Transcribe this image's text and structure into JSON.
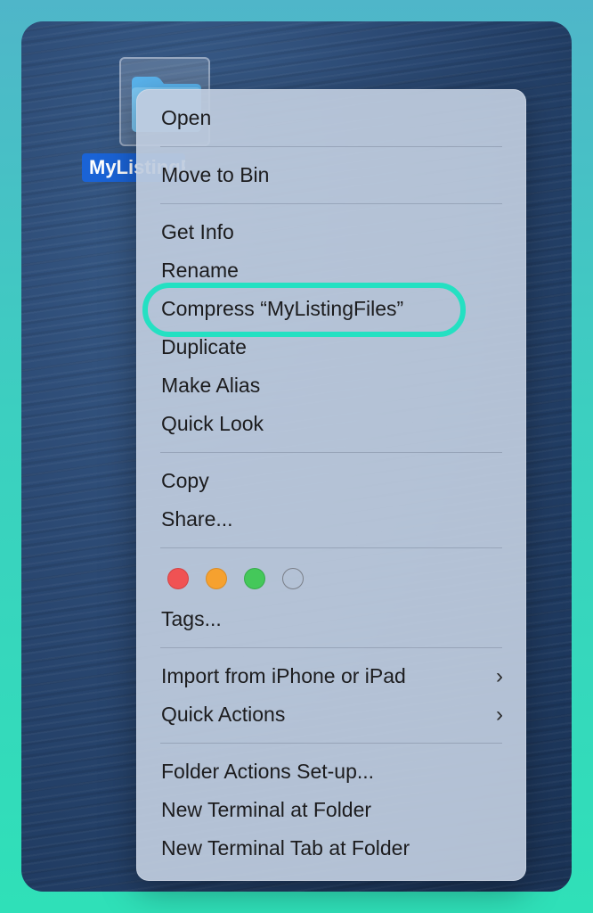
{
  "desktop": {
    "folder": {
      "icon": "folder-icon",
      "label": "MyListingFiles"
    }
  },
  "context_menu": {
    "groups": [
      {
        "items": [
          "Open"
        ]
      },
      {
        "items": [
          "Move to Bin"
        ]
      },
      {
        "items": [
          "Get Info",
          "Rename",
          "Compress “MyListingFiles”",
          "Duplicate",
          "Make Alias",
          "Quick Look"
        ]
      },
      {
        "items": [
          "Copy",
          "Share..."
        ]
      },
      {
        "tags": {
          "colors": [
            {
              "name": "red",
              "hex": "#f05253"
            },
            {
              "name": "orange",
              "hex": "#f6a12f"
            },
            {
              "name": "green",
              "hex": "#44c85a"
            },
            {
              "name": "none",
              "hex": "transparent"
            }
          ],
          "label": "Tags..."
        }
      },
      {
        "items": [
          "Import from iPhone or iPad",
          "Quick Actions"
        ],
        "submenu_icon": "chevron-right-icon"
      },
      {
        "items": [
          "Folder Actions Set-up...",
          "New Terminal at Folder",
          "New Terminal Tab at Folder"
        ]
      }
    ]
  },
  "annotation": {
    "highlighted_item": "Compress “MyListingFiles”",
    "ring_color": "#24e0c2"
  }
}
